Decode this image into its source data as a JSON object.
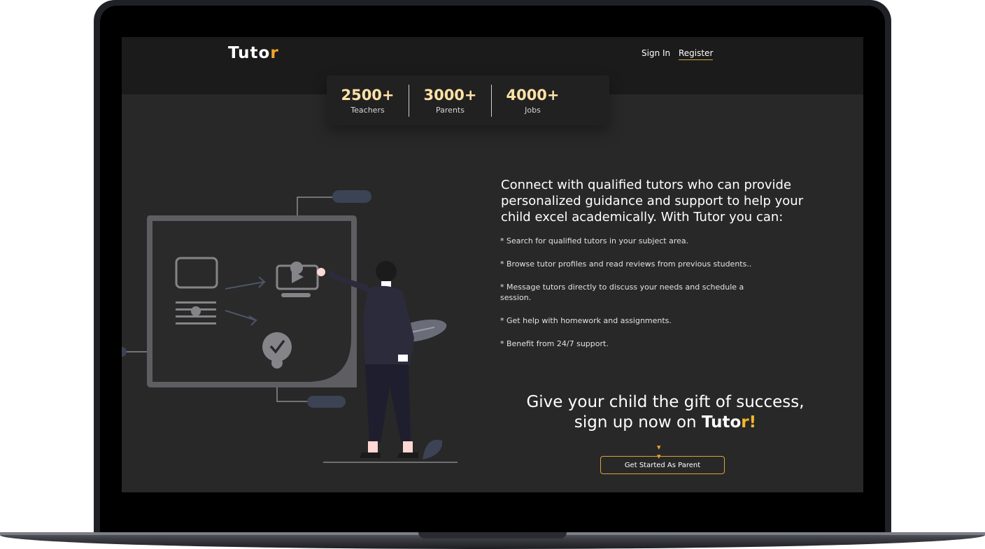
{
  "header": {
    "logo_main": "Tuto",
    "logo_accent": "r",
    "sign_in": "Sign In",
    "register": "Register"
  },
  "stats": [
    {
      "value": "2500+",
      "label": "Teachers"
    },
    {
      "value": "3000+",
      "label": "Parents"
    },
    {
      "value": "4000+",
      "label": "Jobs"
    }
  ],
  "hero": {
    "headline": "Connect with qualified tutors who can provide personalized guidance and support to help your child excel academically. With Tutor you can:",
    "features": [
      "* Search for qualified tutors in your subject area.",
      "* Browse tutor profiles and read reviews from previous students..",
      "* Message tutors directly to discuss your needs and schedule a session.",
      "* Get help with homework and assignments.",
      "* Benefit from 24/7 support."
    ],
    "cta_line1": "Give your child the gift of success,",
    "cta_line2_prefix": "sign up now on ",
    "cta_brand_main": "Tuto",
    "cta_brand_accent": "r!",
    "button": "Get Started As Parent"
  },
  "colors": {
    "accent": "#f3a52c",
    "stat_value": "#ffe2a6",
    "screen_bg": "#282828",
    "header_bg": "#1b1b1b"
  },
  "icons": [
    "chevron-double-down-icon",
    "play-icon",
    "check-icon"
  ]
}
